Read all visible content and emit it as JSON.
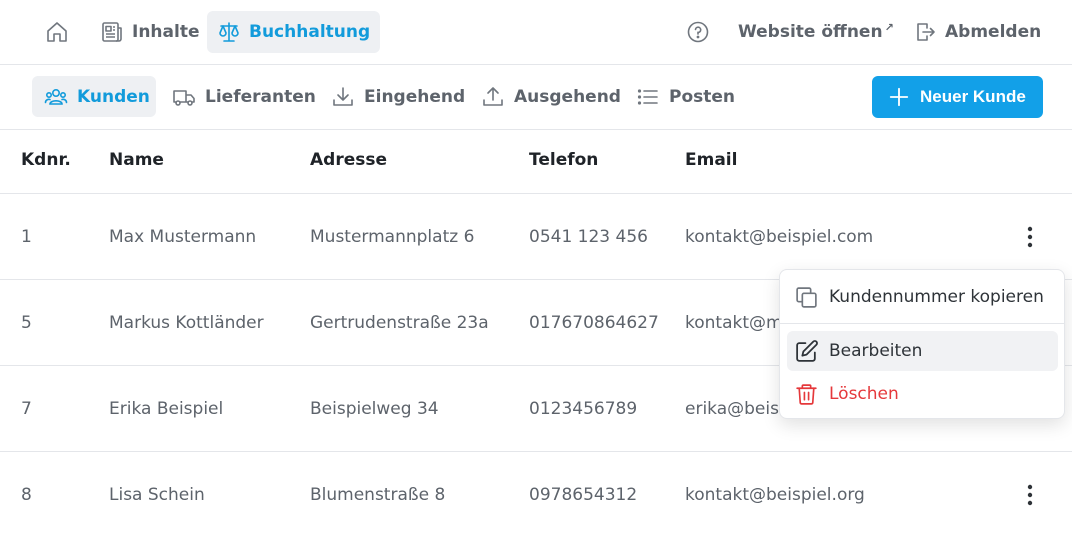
{
  "topnav": {
    "items": [
      {
        "label": ""
      },
      {
        "label": "Inhalte"
      },
      {
        "label": "Buchhaltung"
      }
    ],
    "website_label": "Website öffnen",
    "website_mark": "↗",
    "logout_label": "Abmelden"
  },
  "subnav": {
    "items": [
      {
        "label": "Kunden"
      },
      {
        "label": "Lieferanten"
      },
      {
        "label": "Eingehend"
      },
      {
        "label": "Ausgehend"
      },
      {
        "label": "Posten"
      }
    ],
    "new_button_label": "Neuer Kunde"
  },
  "table": {
    "columns": [
      "Kdnr.",
      "Name",
      "Adresse",
      "Telefon",
      "Email"
    ],
    "rows": [
      {
        "kdnr": "1",
        "name": "Max Mustermann",
        "adresse": "Mustermannplatz 6",
        "telefon": "0541 123 456",
        "email": "kontakt@beispiel.com"
      },
      {
        "kdnr": "5",
        "name": "Markus Kottländer",
        "adresse": "Gertrudenstraße 23a",
        "telefon": "017670864627",
        "email": "kontakt@m"
      },
      {
        "kdnr": "7",
        "name": "Erika Beispiel",
        "adresse": "Beispielweg 34",
        "telefon": "0123456789",
        "email": "erika@beis"
      },
      {
        "kdnr": "8",
        "name": "Lisa Schein",
        "adresse": "Blumenstraße 8",
        "telefon": "0978654312",
        "email": "kontakt@beispiel.org"
      }
    ]
  },
  "context_menu": {
    "copy_label": "Kundennummer kopieren",
    "edit_label": "Bearbeiten",
    "delete_label": "Löschen"
  },
  "colors": {
    "accent": "#129bdb",
    "primary_button": "#12a0e8",
    "danger": "#e5383b"
  },
  "icons": [
    "home-icon",
    "newspaper-icon",
    "scales-icon",
    "help-circle-icon",
    "external-link-icon",
    "logout-icon",
    "users-icon",
    "truck-icon",
    "download-icon",
    "upload-icon",
    "list-icon",
    "plus-icon",
    "kebab-menu-icon",
    "copy-icon",
    "edit-icon",
    "trash-icon"
  ]
}
